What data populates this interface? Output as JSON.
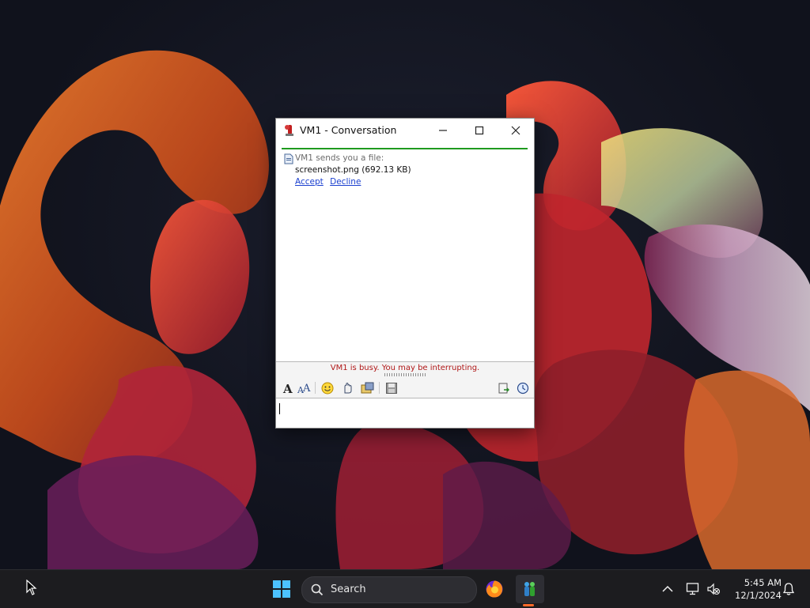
{
  "window": {
    "title": "VM1 - Conversation",
    "min_glyph": "—",
    "max_glyph": "☐",
    "close_glyph": "✕"
  },
  "transcript": {
    "file_offer_text": "VM1 sends you a file:",
    "file_name": "screenshot.png (692.13 KB)",
    "accept_label": "Accept",
    "decline_label": "Decline"
  },
  "status": {
    "message": "VM1 is busy. You may be interrupting."
  },
  "toolbar": {
    "icons": [
      "font-icon",
      "font-color-icon",
      "emoticon-icon",
      "nudge-icon",
      "send-file-icon",
      "save-icon",
      "block-icon",
      "history-icon"
    ]
  },
  "compose": {
    "value": ""
  },
  "taskbar": {
    "search_label": "Search",
    "time": "5:45 AM",
    "date": "12/1/2024",
    "accent_color": "#ff6a2a"
  }
}
